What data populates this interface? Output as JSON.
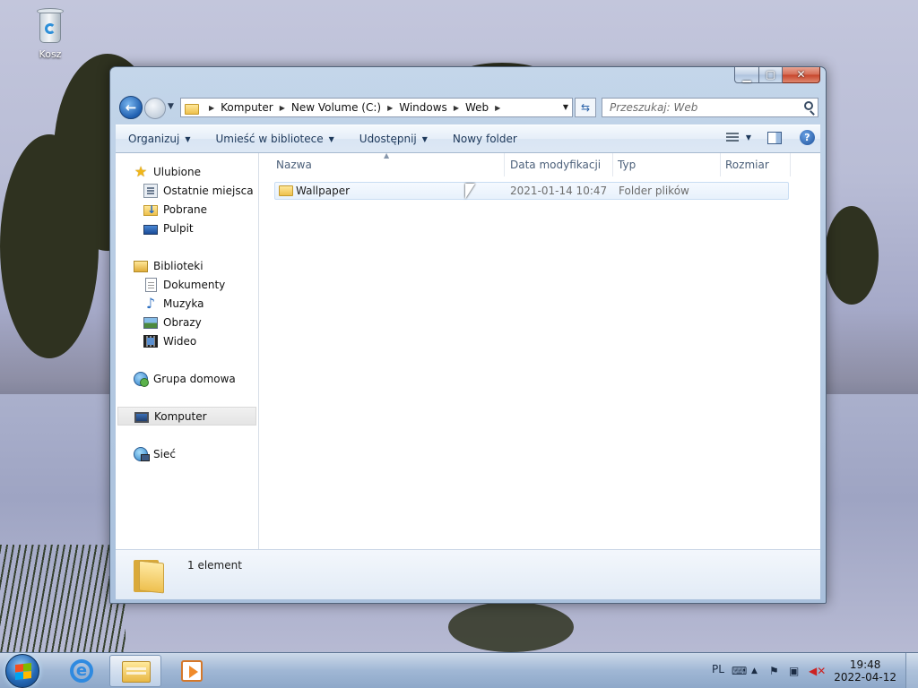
{
  "desktop": {
    "recycle_bin_label": "Kosz"
  },
  "window": {
    "buttons": {
      "minimize": "▁",
      "maximize": "▢",
      "close": "✕"
    }
  },
  "address_bar": {
    "crumbs": [
      "Komputer",
      "New Volume (C:)",
      "Windows",
      "Web"
    ],
    "search_placeholder": "Przeszukaj: Web"
  },
  "command_bar": {
    "organize": "Organizuj",
    "include_in_library": "Umieść w bibliotece",
    "share": "Udostępnij",
    "new_folder": "Nowy folder"
  },
  "navigation": {
    "favorites": "Ulubione",
    "recent": "Ostatnie miejsca",
    "downloads": "Pobrane",
    "desktop": "Pulpit",
    "libraries": "Biblioteki",
    "documents": "Dokumenty",
    "music": "Muzyka",
    "pictures": "Obrazy",
    "videos": "Wideo",
    "homegroup": "Grupa domowa",
    "computer": "Komputer",
    "network": "Sieć"
  },
  "columns": {
    "name": "Nazwa",
    "date": "Data modyfikacji",
    "type": "Typ",
    "size": "Rozmiar"
  },
  "files": [
    {
      "name": "Wallpaper",
      "date": "2021-01-14 10:47",
      "type": "Folder plików",
      "size": ""
    }
  ],
  "details_pane": {
    "count": "1 element"
  },
  "taskbar": {
    "language": "PL",
    "time": "19:48",
    "date": "2022-04-12"
  },
  "colors": {
    "accent": "#1f5fb0",
    "close_button": "#c7442a",
    "selected_row": "#e7f1fc"
  }
}
